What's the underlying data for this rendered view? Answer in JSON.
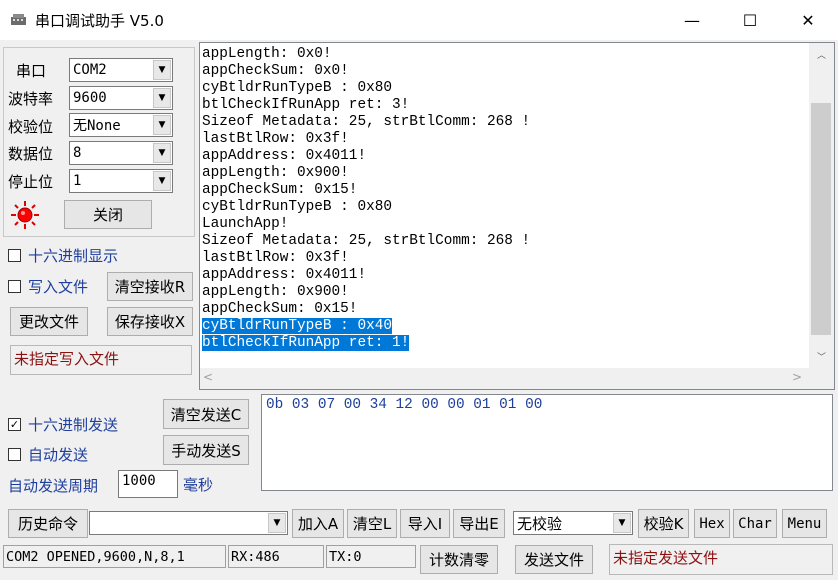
{
  "window": {
    "title": "串口调试助手 V5.0",
    "minimize": "—",
    "maximize": "☐",
    "close": "✕"
  },
  "settings": {
    "port_label": "串口",
    "port_value": "COM2",
    "baud_label": "波特率",
    "baud_value": "9600",
    "parity_label": "校验位",
    "parity_value": "无None",
    "databits_label": "数据位",
    "databits_value": "8",
    "stopbits_label": "停止位",
    "stopbits_value": "1",
    "close_button": "关闭"
  },
  "receive_options": {
    "hex_display": "十六进制显示",
    "write_file": "写入文件",
    "clear_receive": "清空接收R",
    "change_file": "更改文件",
    "save_receive": "保存接收X",
    "file_status": "未指定写入文件"
  },
  "receive_log": {
    "lines": [
      "appLength: 0x0!",
      "appCheckSum: 0x0!",
      "cyBtldrRunTypeB : 0x80",
      "btlCheckIfRunApp ret: 3!",
      "Sizeof Metadata: 25, strBtlComm: 268 !",
      "lastBtlRow: 0x3f!",
      "appAddress: 0x4011!",
      "appLength: 0x900!",
      "appCheckSum: 0x15!",
      "cyBtldrRunTypeB : 0x80",
      "LaunchApp!",
      "Sizeof Metadata: 25, strBtlComm: 268 !",
      "lastBtlRow: 0x3f!",
      "appAddress: 0x4011!",
      "appLength: 0x900!",
      "appCheckSum: 0x15!"
    ],
    "selected_lines": [
      "cyBtldrRunTypeB : 0x40",
      "btlCheckIfRunApp ret: 1!"
    ]
  },
  "send_options": {
    "hex_send": "十六进制发送",
    "hex_send_checked": true,
    "auto_send": "自动发送",
    "clear_send": "清空发送C",
    "manual_send": "手动发送S",
    "period_label": "自动发送周期",
    "period_value": "1000",
    "period_unit": "毫秒"
  },
  "send_data": "0b 03 07 00 34 12 00 00 01 01 00",
  "bottom": {
    "history_label": "历史命令",
    "history_value": "",
    "add": "加入A",
    "clear": "清空L",
    "import": "导入I",
    "export": "导出E",
    "checksum_value": "无校验",
    "checksum_btn": "校验K",
    "hex": "Hex",
    "char": "Char",
    "menu": "Menu"
  },
  "status": {
    "port_state": "COM2 OPENED,9600,N,8,1",
    "rx": "RX:486",
    "tx": "TX:0",
    "clear_counter": "计数清零",
    "send_file": "发送文件",
    "send_file_status": "未指定发送文件"
  },
  "colors": {
    "selection": "#0078d7",
    "label_blue": "#1d3e9c",
    "status_red": "#8b1010",
    "led_red": "#ff0000"
  },
  "icons": {
    "app": "serial-port-icon",
    "led": "red-led-icon",
    "dropdown": "chevron-down-icon",
    "scroll_left": "chevron-left-icon",
    "scroll_right": "chevron-right-icon",
    "scroll_up": "chevron-up-icon",
    "scroll_down": "chevron-down-icon"
  }
}
